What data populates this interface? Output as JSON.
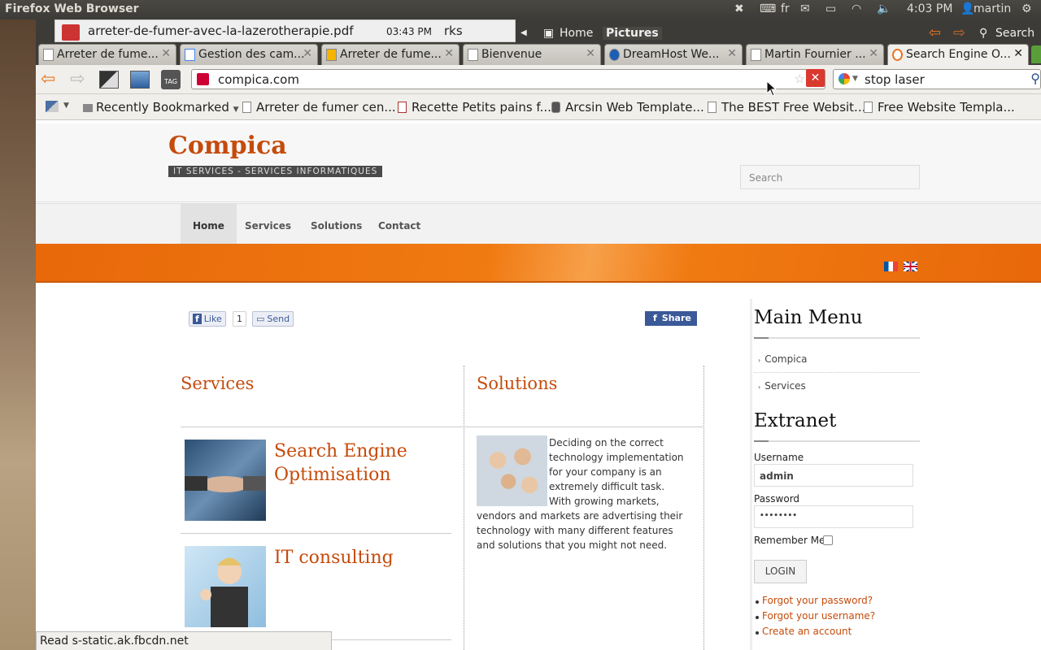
{
  "system": {
    "app_title": "Firefox Web Browser",
    "keyboard": "fr",
    "clock": "4:03 PM",
    "user": "martin"
  },
  "downloads": {
    "filename": "arreter-de-fumer-avec-la-lazerotherapie.pdf",
    "time": "03:43 PM",
    "behind_text": "rks"
  },
  "places": {
    "home": "Home",
    "pictures": "Pictures",
    "search": "Search"
  },
  "tabs": [
    {
      "label": "Arreter de fume..."
    },
    {
      "label": "Gestion des cam..."
    },
    {
      "label": "Arreter de fume..."
    },
    {
      "label": "Bienvenue"
    },
    {
      "label": "DreamHost We..."
    },
    {
      "label": "Martin Fournier ..."
    },
    {
      "label": "Search Engine O..."
    }
  ],
  "navbar": {
    "url": "compica.com",
    "search_query": "stop laser"
  },
  "bookmarks": [
    {
      "label": "Recently Bookmarked"
    },
    {
      "label": "Arreter de fumer cen..."
    },
    {
      "label": "Recette Petits pains f..."
    },
    {
      "label": "Arcsin Web Template..."
    },
    {
      "label": "The BEST Free Websit..."
    },
    {
      "label": "Free Website Templa..."
    }
  ],
  "site": {
    "logo": "Compica",
    "tagline": "IT SERVICES - SERVICES INFORMATIQUES",
    "search_placeholder": "Search",
    "menu": [
      "Home",
      "Services",
      "Solutions",
      "Contact"
    ],
    "fb_like": "Like",
    "fb_count": "1",
    "fb_send": "Send",
    "fb_share": "Share",
    "services_title": "Services",
    "solutions_title": "Solutions",
    "service_items": [
      "Search Engine Optimisation",
      "IT consulting"
    ],
    "solutions_text": "Deciding on the correct technology implementation for your company is an extremely difficult task.  With growing markets, vendors and markets are advertising their technology with many different features and solutions that you might not need."
  },
  "sidebar": {
    "main_menu_title": "Main Menu",
    "menu_items": [
      "Compica",
      "Services"
    ],
    "extranet_title": "Extranet",
    "username_label": "Username",
    "username_value": "admin",
    "password_label": "Password",
    "password_value": "••••••••",
    "remember_label": "Remember Me",
    "login_label": "LOGIN",
    "links": [
      "Forgot your password?",
      "Forgot your username?",
      "Create an account"
    ]
  },
  "status": "Read s-static.ak.fbcdn.net",
  "colors": {
    "brand_orange": "#c54b0c",
    "band_orange": "#f07a12"
  }
}
